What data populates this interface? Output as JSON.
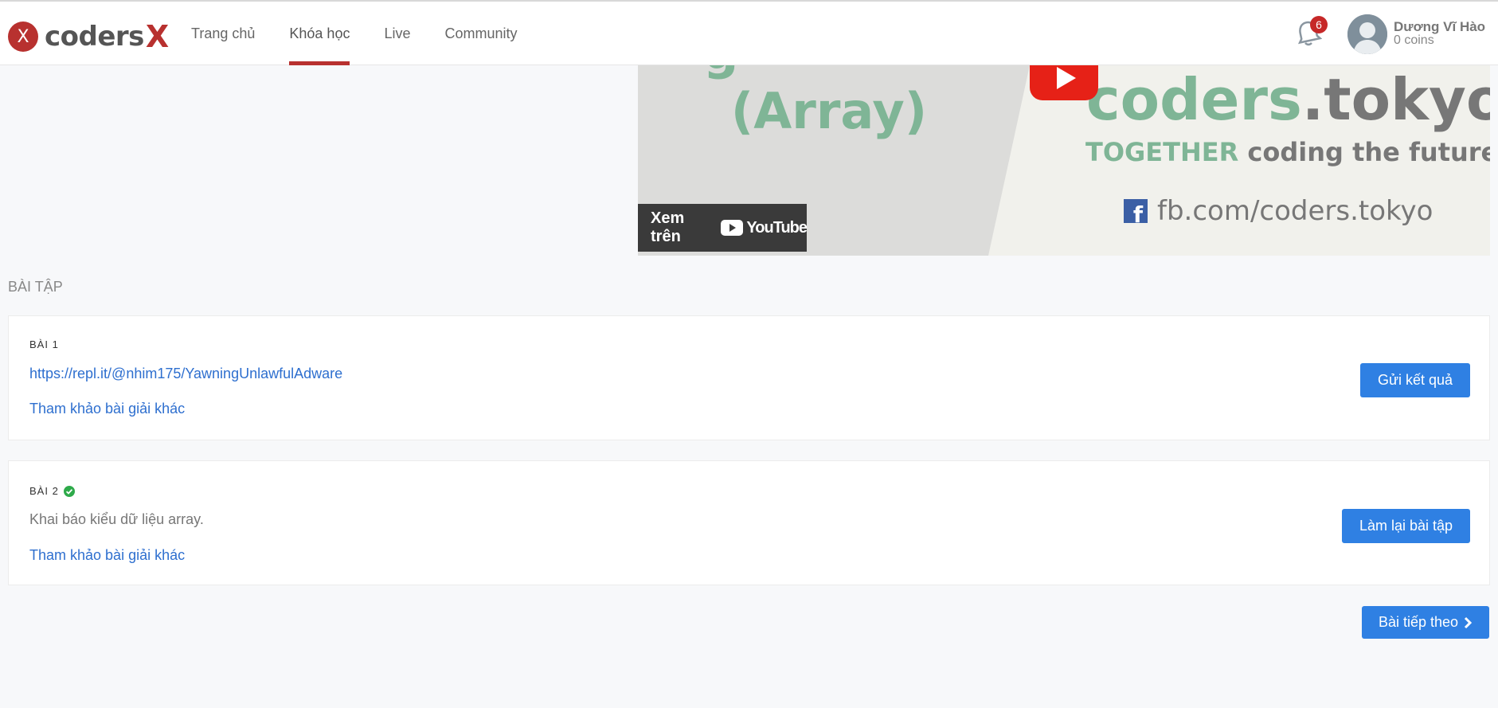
{
  "header": {
    "logo_badge": "X",
    "logo_text": "coders",
    "logo_accent": "X",
    "nav": [
      {
        "label": "Trang chủ",
        "active": false
      },
      {
        "label": "Khóa học",
        "active": true
      },
      {
        "label": "Live",
        "active": false
      },
      {
        "label": "Community",
        "active": false
      }
    ],
    "notifications_count": "6",
    "user_name": "Dương Vĩ Hào",
    "user_coins": "0 coins"
  },
  "video": {
    "title_fragment": "(Array)",
    "brand_main": "coders",
    "brand_suffix": ".tokyo",
    "tagline_accent": "TOGETHER",
    "tagline_rest": " coding the future",
    "facebook_url": "fb.com/coders.tokyo",
    "watch_on_label": "Xem trên",
    "youtube_label": "YouTube"
  },
  "section": {
    "title": "BÀI TẬP"
  },
  "exercises": [
    {
      "label": "BÀI 1",
      "completed": false,
      "link": "https://repl.it/@nhim175/YawningUnlawfulAdware",
      "reference_link": "Tham khảo bài giải khác",
      "button": "Gửi kết quả"
    },
    {
      "label": "BÀI 2",
      "completed": true,
      "description": "Khai báo kiểu dữ liệu array.",
      "reference_link": "Tham khảo bài giải khác",
      "button": "Làm lại bài tập"
    }
  ],
  "next_button": "Bài tiếp theo",
  "colors": {
    "brand_red": "#b8312f",
    "button_blue": "#2f80e3",
    "link_blue": "#2e6fcf",
    "brand_green": "#7fb596",
    "youtube_red": "#e62117",
    "check_green": "#2eaa4a"
  },
  "icons": {
    "notification": "bell-icon",
    "avatar": "user-silhouette-icon",
    "play": "youtube-play-icon",
    "facebook": "facebook-icon",
    "completed": "check-circle-icon",
    "next": "chevron-right-icon"
  }
}
